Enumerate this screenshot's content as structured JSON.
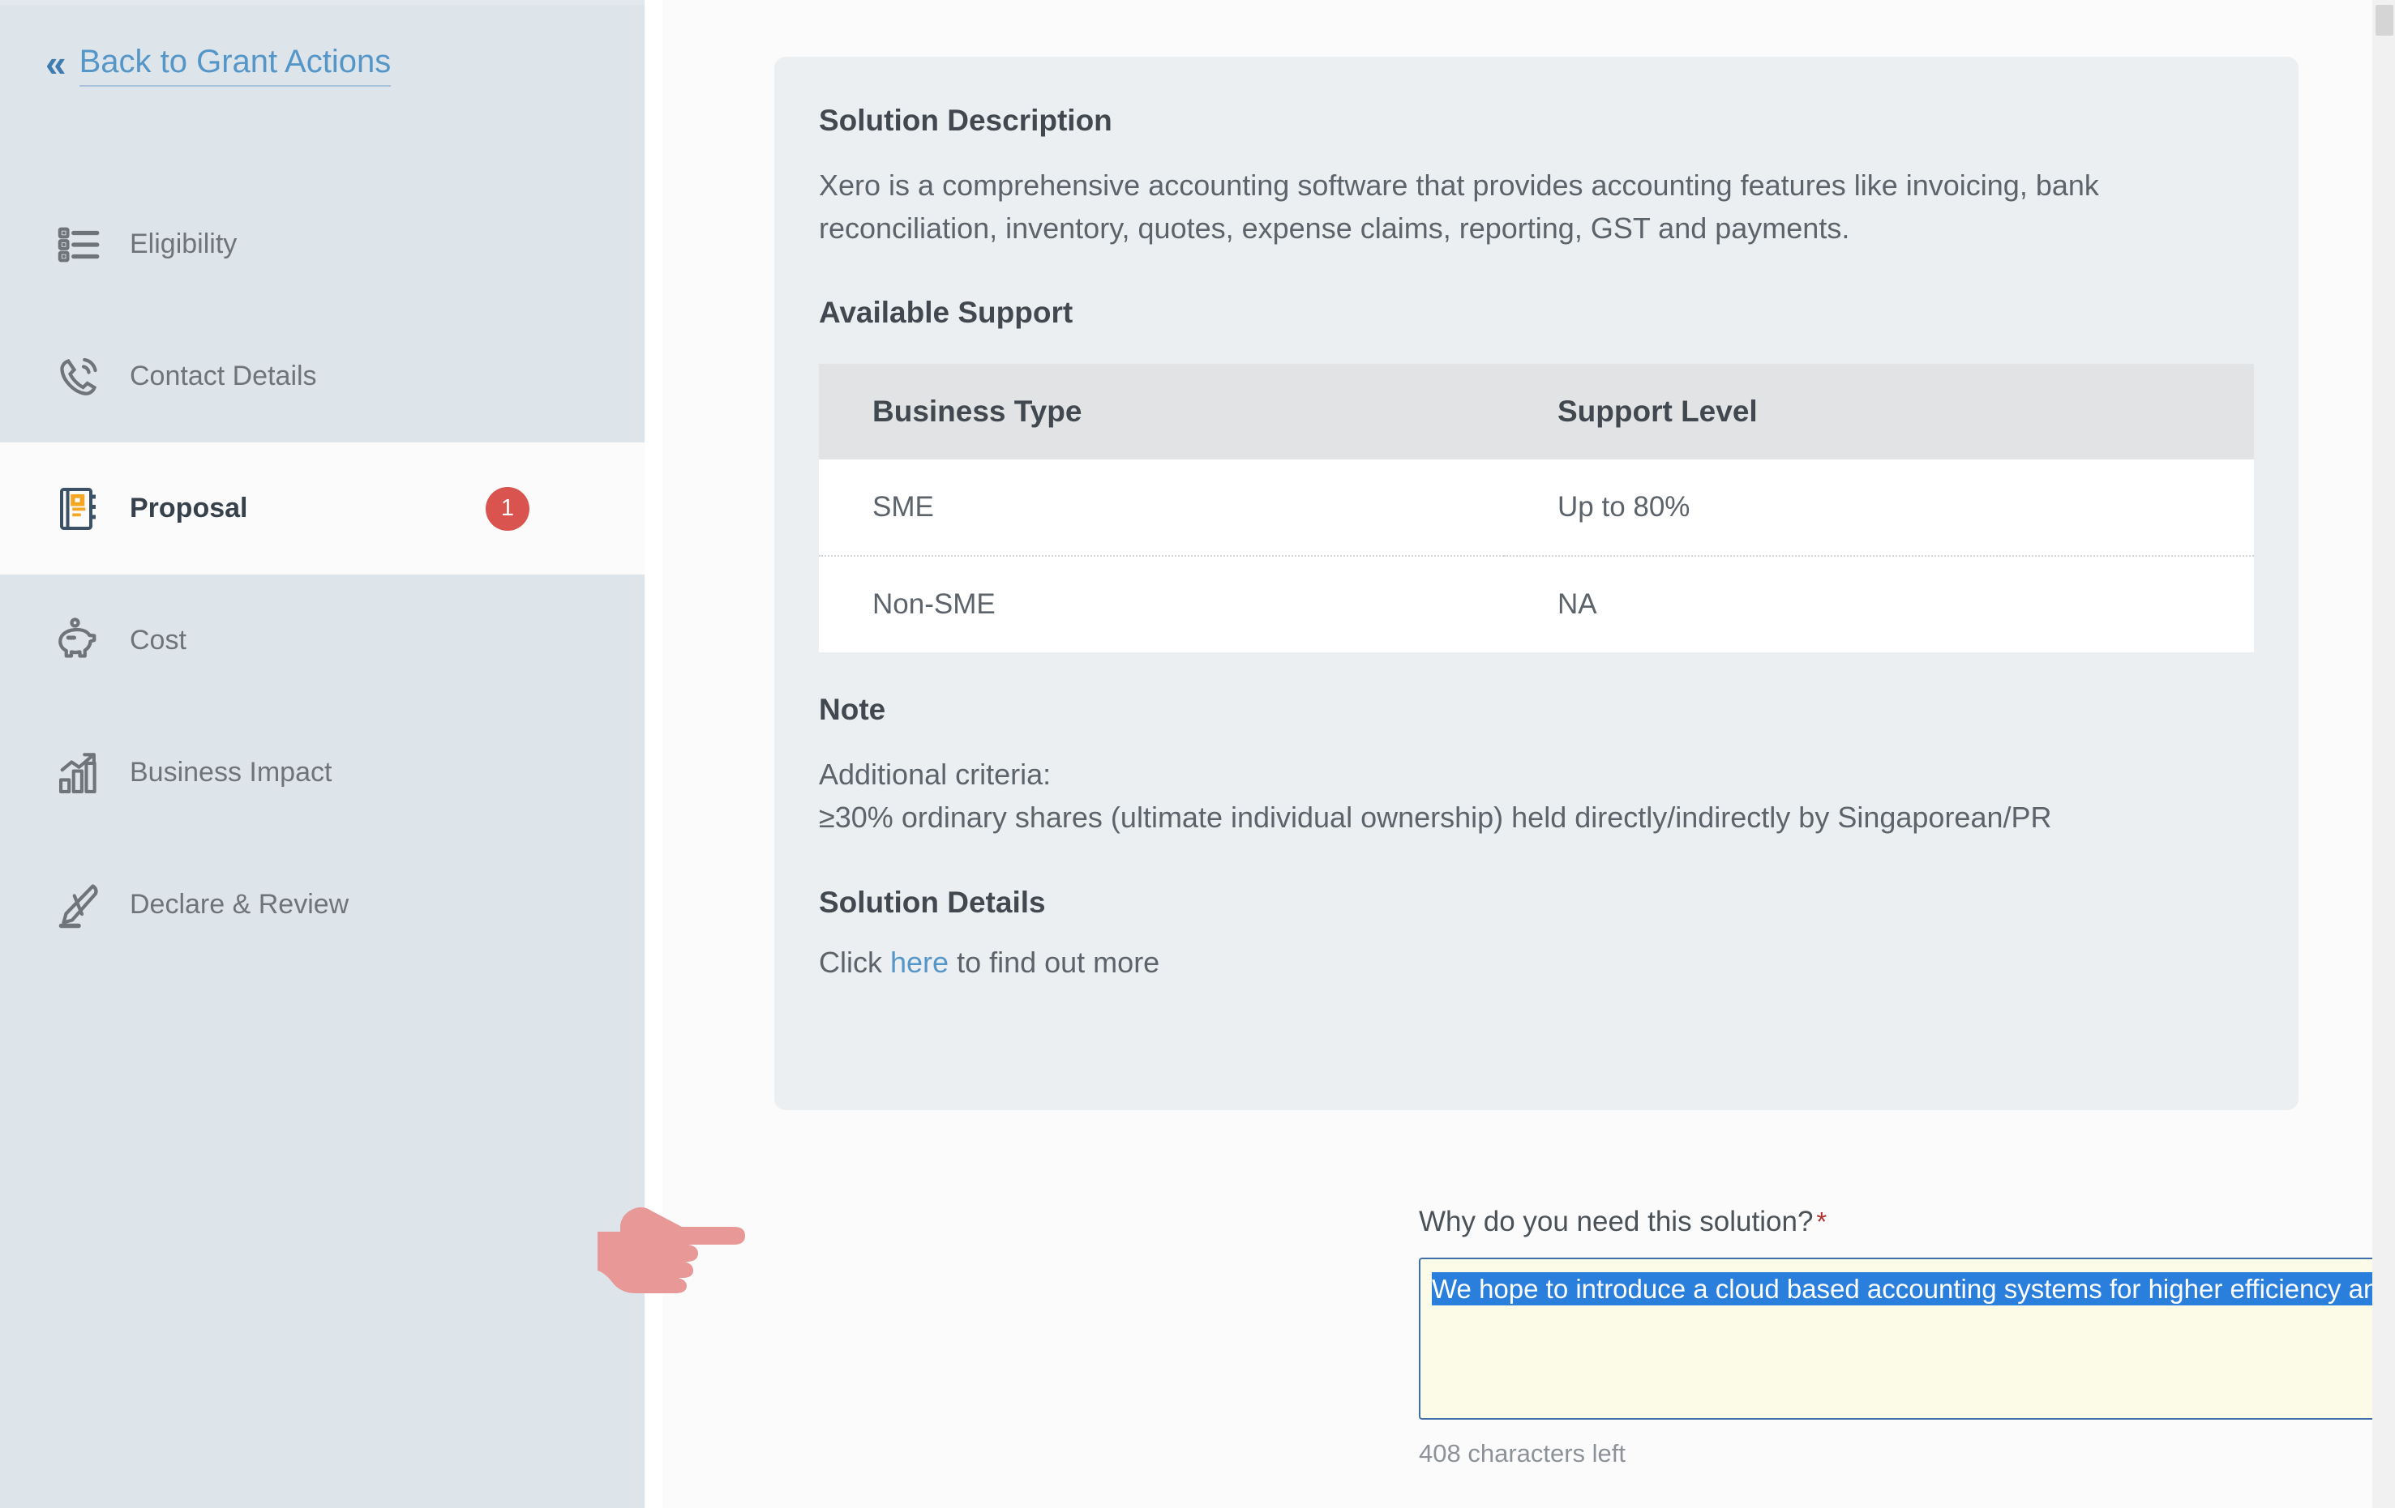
{
  "sidebar": {
    "back_link": {
      "label": "Back to Grant Actions",
      "icon": "double-chevron-left-icon"
    },
    "items": [
      {
        "label": "Eligibility",
        "icon": "checklist-icon",
        "active": false,
        "badge": ""
      },
      {
        "label": "Contact Details",
        "icon": "phone-icon",
        "active": false,
        "badge": ""
      },
      {
        "label": "Proposal",
        "icon": "notebook-icon",
        "active": true,
        "badge": "1"
      },
      {
        "label": "Cost",
        "icon": "piggy-bank-icon",
        "active": false,
        "badge": ""
      },
      {
        "label": "Business Impact",
        "icon": "bar-chart-icon",
        "active": false,
        "badge": ""
      },
      {
        "label": "Declare & Review",
        "icon": "pen-icon",
        "active": false,
        "badge": ""
      }
    ]
  },
  "card": {
    "solution_description_heading": "Solution Description",
    "solution_description_text": "Xero is a comprehensive accounting software that provides accounting features like invoicing, bank reconciliation, inventory, quotes, expense claims, reporting, GST and payments.",
    "available_support_heading": "Available Support",
    "table": {
      "headers": [
        "Business Type",
        "Support Level"
      ],
      "rows": [
        [
          "SME",
          "Up to 80%"
        ],
        [
          "Non-SME",
          "NA"
        ]
      ]
    },
    "note_heading": "Note",
    "note_line_1": "Additional criteria:",
    "note_line_2": "≥30% ordinary shares (ultimate individual ownership) held directly/indirectly by Singaporean/PR",
    "solution_details_heading": "Solution Details",
    "details_prefix": "Click ",
    "details_link": "here",
    "details_suffix": " to find out more"
  },
  "form": {
    "question_label": "Why do you need this solution?",
    "required_marker": "*",
    "answer_value": "We hope to introduce a cloud based accounting systems for higher efficiency and productivity",
    "answer_placeholder": "",
    "char_counter": "408 characters left"
  },
  "colors": {
    "sidebar_bg": "#dde4ea",
    "accent_link": "#5596c8",
    "badge_red": "#d9534f",
    "card_bg": "#eceff1",
    "selection_blue": "#2a7fdc",
    "autofill_cream": "#fcfbe7",
    "pointer_pink": "#e8909090"
  }
}
